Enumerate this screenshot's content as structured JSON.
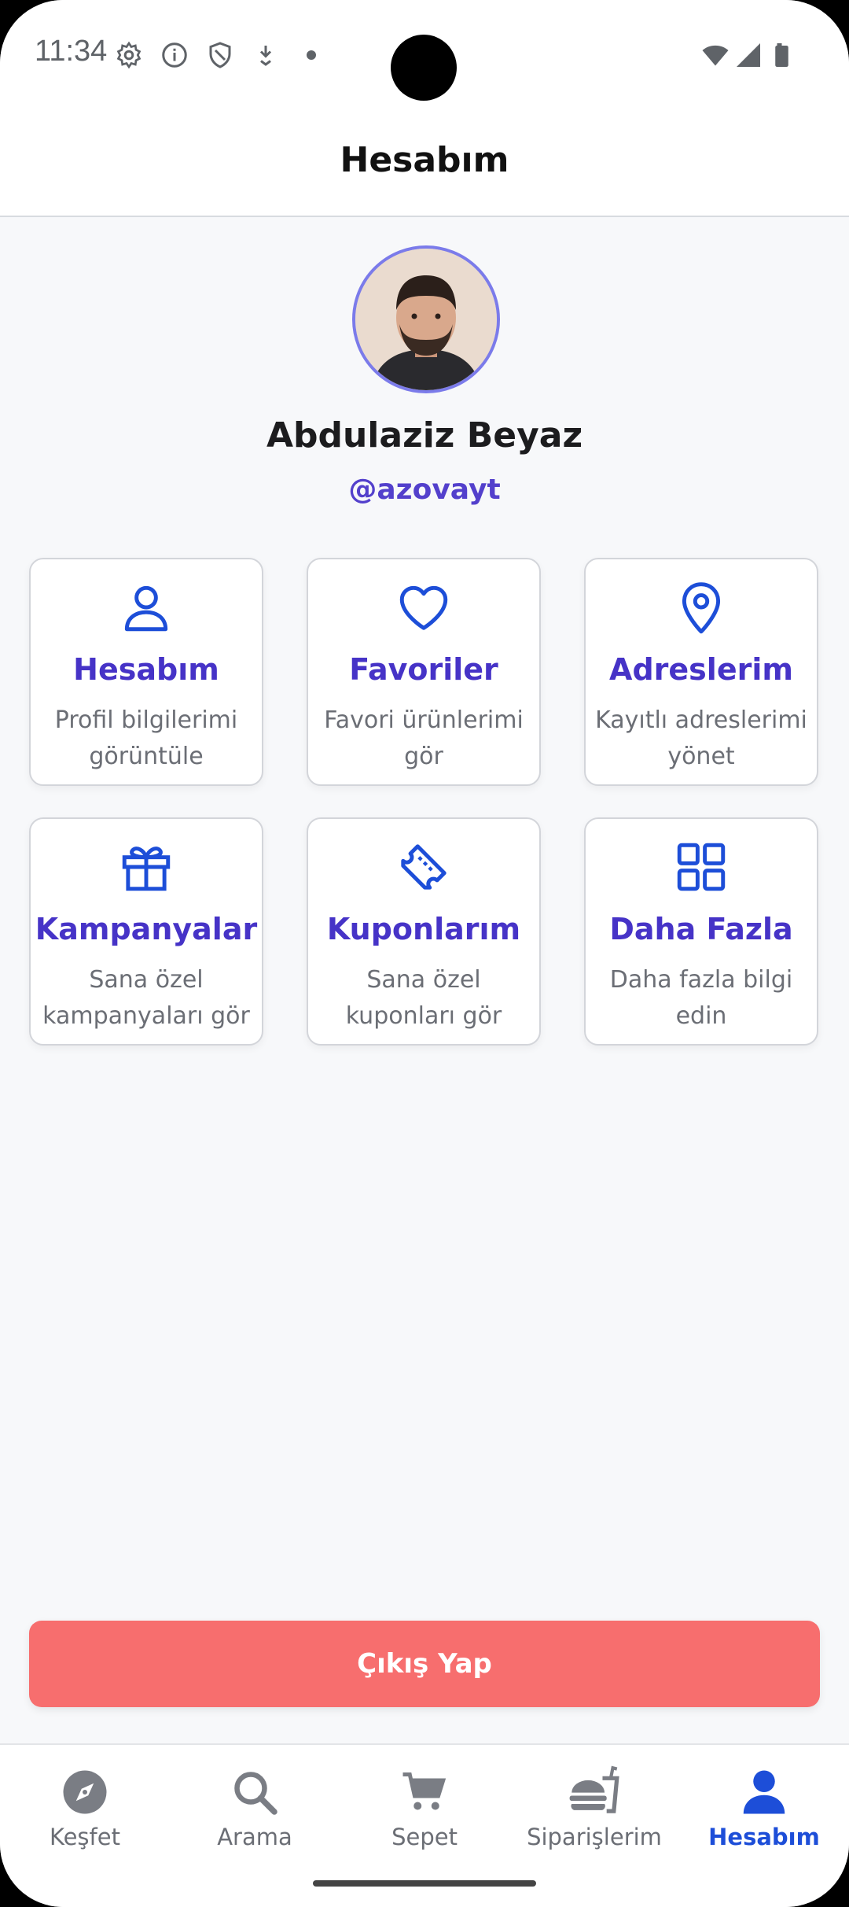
{
  "status_bar": {
    "time": "11:34",
    "icons": [
      "settings-icon",
      "info-icon",
      "shield-icon",
      "download-icon",
      "dot-icon",
      "wifi-icon",
      "signal-icon",
      "battery-icon"
    ]
  },
  "header": {
    "title": "Hesabım"
  },
  "profile": {
    "name": "Abdulaziz Beyaz",
    "handle": "@azovayt"
  },
  "menu": [
    {
      "icon": "user-icon",
      "title": "Hesabım",
      "desc": "Profil bilgilerimi görüntüle"
    },
    {
      "icon": "heart-icon",
      "title": "Favoriler",
      "desc": "Favori ürünlerimi gör"
    },
    {
      "icon": "location-pin-icon",
      "title": "Adreslerim",
      "desc": "Kayıtlı adreslerimi yönet"
    },
    {
      "icon": "gift-icon",
      "title": "Kampanyalar",
      "desc": "Sana özel kampanyaları gör"
    },
    {
      "icon": "ticket-icon",
      "title": "Kuponlarım",
      "desc": "Sana özel kuponları gör"
    },
    {
      "icon": "grid-icon",
      "title": "Daha Fazla",
      "desc": "Daha fazla bilgi edin"
    }
  ],
  "logout_label": "Çıkış Yap",
  "nav": [
    {
      "icon": "compass-icon",
      "label": "Keşfet",
      "active": false
    },
    {
      "icon": "search-icon",
      "label": "Arama",
      "active": false
    },
    {
      "icon": "cart-icon",
      "label": "Sepet",
      "active": false
    },
    {
      "icon": "food-icon",
      "label": "Siparişlerim",
      "active": false
    },
    {
      "icon": "person-icon",
      "label": "Hesabım",
      "active": true
    }
  ],
  "colors": {
    "accent": "#4633c7",
    "icon_blue": "#1d4ed8",
    "logout": "#f76e6e",
    "background": "#f7f8fa"
  }
}
